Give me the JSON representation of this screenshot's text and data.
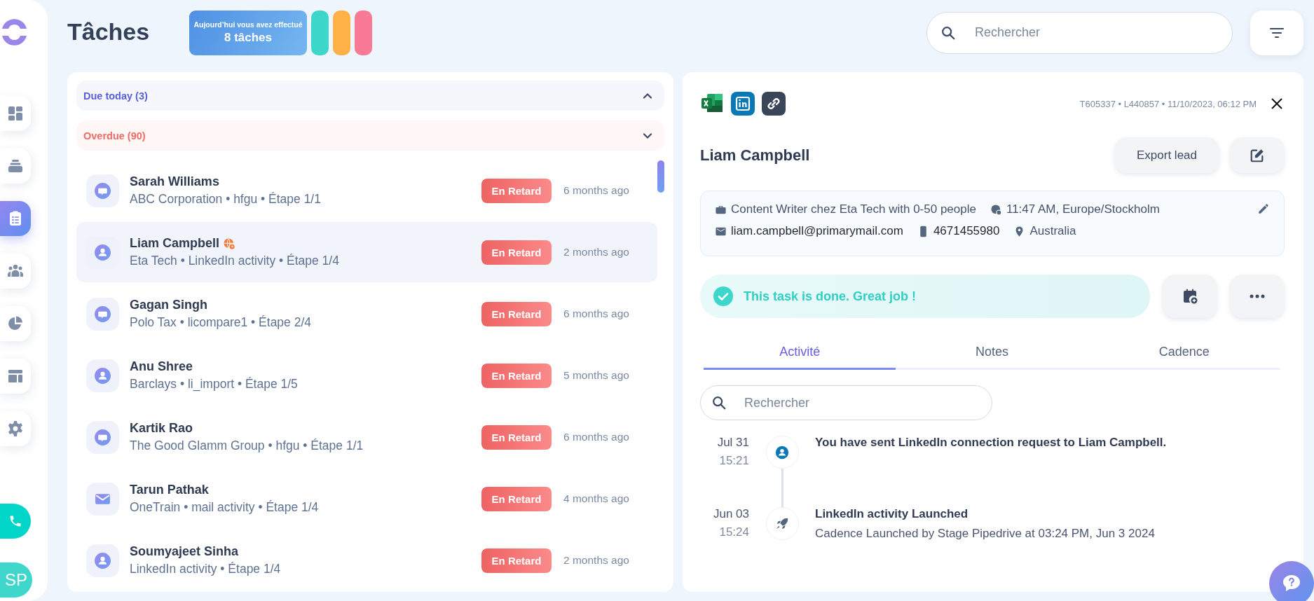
{
  "sidebar": {
    "nav": [
      {
        "kind": "dashboard",
        "selected": false
      },
      {
        "kind": "inbox",
        "selected": false
      },
      {
        "kind": "tasks",
        "selected": true
      },
      {
        "kind": "people",
        "selected": false
      },
      {
        "kind": "chart",
        "selected": false
      },
      {
        "kind": "layout",
        "selected": false
      },
      {
        "kind": "settings",
        "selected": false
      }
    ],
    "avatar": {
      "initials": "SP"
    }
  },
  "header": {
    "title": "Tâches",
    "banner": {
      "caption": "Aujourd’hui vous avez effectué",
      "count": "8 tâches"
    },
    "streak_bars": [
      {
        "color": "#3dd6cb"
      },
      {
        "color": "#fdb147"
      },
      {
        "color": "#f97a95"
      }
    ],
    "search": {
      "placeholder": "Rechercher"
    }
  },
  "task_groups": [
    {
      "label": "Due today (3)",
      "kind": "today",
      "expanded": false
    },
    {
      "label": "Overdue (90)",
      "kind": "overdue",
      "expanded": true
    }
  ],
  "tasks": [
    {
      "kind": "message",
      "name": "Sarah Williams",
      "subtitle": "ABC Corporation • hfgu • Étape 1/1",
      "badge": "En Retard",
      "time": "6 months ago",
      "selected": false,
      "timezone_alert": false
    },
    {
      "kind": "person",
      "name": "Liam Campbell",
      "subtitle": "Eta Tech • LinkedIn activity • Étape 1/4",
      "badge": "En Retard",
      "time": "2 months ago",
      "selected": true,
      "timezone_alert": true
    },
    {
      "kind": "message",
      "name": "Gagan Singh",
      "subtitle": "Polo Tax • licompare1 • Étape 2/4",
      "badge": "En Retard",
      "time": "6 months ago",
      "selected": false,
      "timezone_alert": false
    },
    {
      "kind": "person",
      "name": "Anu Shree",
      "subtitle": "Barclays • li_import • Étape 1/5",
      "badge": "En Retard",
      "time": "5 months ago",
      "selected": false,
      "timezone_alert": false
    },
    {
      "kind": "message",
      "name": "Kartik Rao",
      "subtitle": "The Good Glamm Group • hfgu • Étape 1/1",
      "badge": "En Retard",
      "time": "6 months ago",
      "selected": false,
      "timezone_alert": false
    },
    {
      "kind": "mail",
      "name": "Tarun Pathak",
      "subtitle": "OneTrain • mail activity • Étape 1/4",
      "badge": "En Retard",
      "time": "4 months ago",
      "selected": false,
      "timezone_alert": false
    },
    {
      "kind": "person",
      "name": "Soumyajeet Sinha",
      "subtitle": "LinkedIn activity • Étape 1/4",
      "badge": "En Retard",
      "time": "2 months ago",
      "selected": false,
      "timezone_alert": false
    }
  ],
  "detail": {
    "sources": [
      {
        "kind": "excel"
      },
      {
        "kind": "linkedin"
      },
      {
        "kind": "link"
      }
    ],
    "meta": "T605337 • L440857 • 11/10/2023, 06:12 PM",
    "name": "Liam Campbell",
    "export_button": "Export lead",
    "info_rows": [
      [
        {
          "kind": "job",
          "text": "Content Writer chez Eta Tech with 0-50 people"
        },
        {
          "kind": "timezone",
          "text": "11:47 AM, Europe/Stockholm"
        }
      ],
      [
        {
          "kind": "email",
          "text": "liam.campbell@primarymail.com"
        },
        {
          "kind": "phone",
          "text": "4671455980"
        },
        {
          "kind": "location",
          "text": "Australia"
        }
      ]
    ],
    "status": "This task is done. Great job !",
    "tabs": [
      {
        "label": "Activité",
        "selected": true
      },
      {
        "label": "Notes",
        "selected": false
      },
      {
        "label": "Cadence",
        "selected": false
      }
    ],
    "search": {
      "placeholder": "Rechercher"
    },
    "timeline": [
      {
        "kind": "linkedin",
        "date": "Jul 31",
        "time": "15:21",
        "title": "You have sent LinkedIn connection request to Liam Campbell."
      },
      {
        "kind": "launch",
        "date": "Jun 03",
        "time": "15:24",
        "title": "LinkedIn activity Launched",
        "detail": "Cadence Launched by Stage Pipedrive at 03:24 PM, Jun 3 2024"
      }
    ]
  }
}
